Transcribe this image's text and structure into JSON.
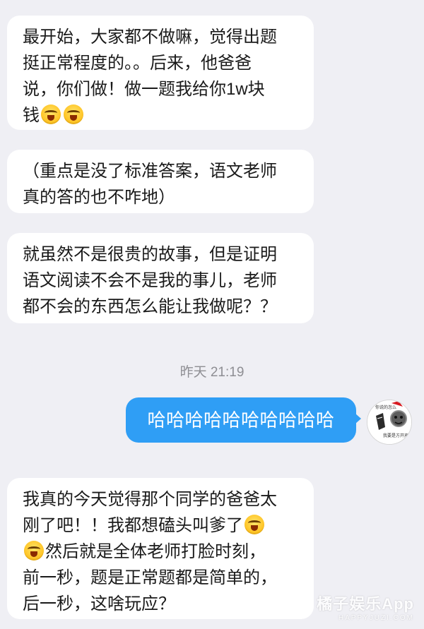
{
  "messages": [
    {
      "side": "left",
      "lines": [
        "最开始，大家都不做嘛，觉得出题",
        "挺正常程度的。。后来，他爸爸",
        "说，你们做！做一题我给你1w块",
        "钱"
      ],
      "trailing_emojis": [
        "tears-of-joy-emoji",
        "tears-of-joy-emoji"
      ]
    },
    {
      "side": "left",
      "lines": [
        "（重点是没了标准答案，语文老师",
        "真的答的也不咋地）"
      ]
    },
    {
      "side": "left",
      "lines": [
        "就虽然不是很贵的故事，但是证明",
        "语文阅读不会不是我的事儿，老师",
        "都不会的东西怎么能让我做呢？？"
      ]
    },
    {
      "side": "right",
      "text": "哈哈哈哈哈哈哈哈哈哈"
    },
    {
      "side": "left",
      "segments": {
        "line1": "我真的今天觉得那个同学的爸爸太",
        "line2": "刚了吧！！我都想磕头叫爹了",
        "line3": "然后就是全体老师打脸时刻，",
        "line4": "前一秒，题是正常题都是简单的，",
        "line5": "后一秒，这啥玩应？"
      }
    }
  ],
  "timestamp": "昨天 21:19",
  "avatar": {
    "icon": "meme-avatar-icon",
    "caption_top": "你说的怎么",
    "caption_bottom": "我要是方开声",
    "hat_color": "#d71920"
  },
  "watermark": {
    "main": "橘子娱乐App",
    "sub": "HAPPYJUZI.COM"
  },
  "colors": {
    "background": "#efeff4",
    "incoming_bubble": "#ffffff",
    "outgoing_bubble": "#2f9ef5",
    "timestamp": "#8e8e93"
  }
}
